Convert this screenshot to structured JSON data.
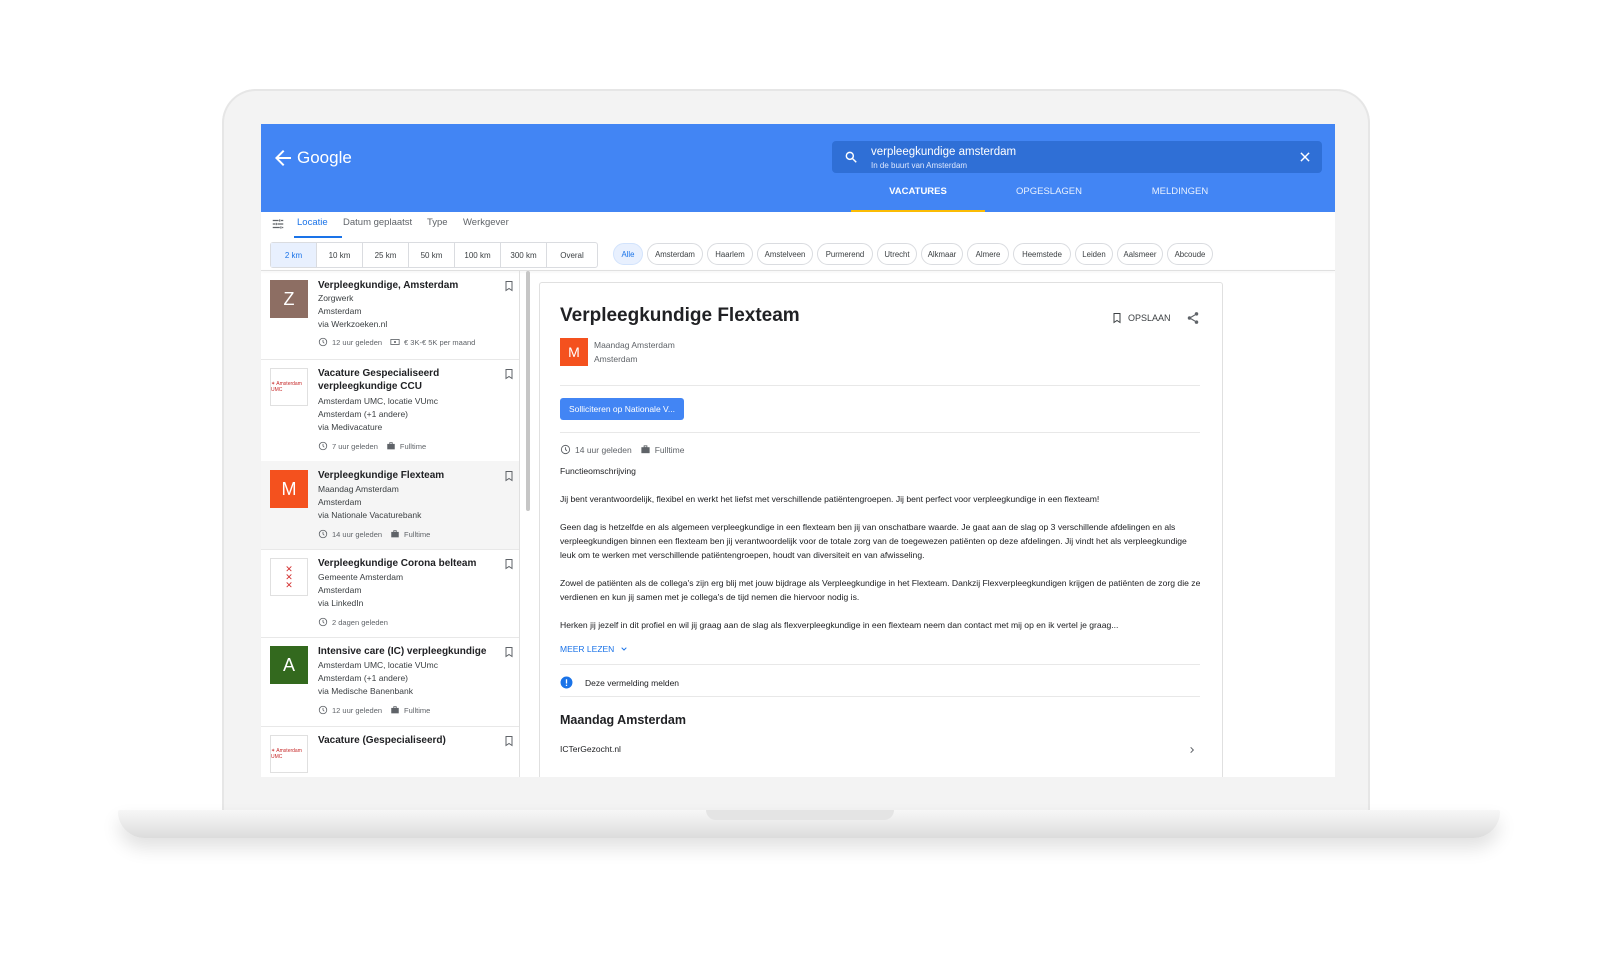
{
  "header": {
    "brand": "Google",
    "search_query": "verpleegkundige amsterdam",
    "search_subtitle": "In de buurt van Amsterdam",
    "tabs": [
      "VACATURES",
      "OPGESLAGEN",
      "MELDINGEN"
    ]
  },
  "filters": {
    "tabs": [
      "Locatie",
      "Datum geplaatst",
      "Type",
      "Werkgever"
    ],
    "distances": [
      "2 km",
      "10 km",
      "25 km",
      "50 km",
      "100 km",
      "300 km",
      "Overal"
    ],
    "chips": [
      "Alle",
      "Amsterdam",
      "Haarlem",
      "Amstelveen",
      "Purmerend",
      "Utrecht",
      "Alkmaar",
      "Almere",
      "Heemstede",
      "Leiden",
      "Aalsmeer",
      "Abcoude"
    ]
  },
  "jobs": [
    {
      "title": "Verpleegkundige, Amsterdam",
      "company": "Zorgwerk",
      "location": "Amsterdam",
      "via": "via Werkzoeken.nl",
      "age": "12 uur geleden",
      "extra": "€ 3K-€ 5K per maand",
      "logo_letter": "Z",
      "logo_color": "#8d6e63"
    },
    {
      "title": "Vacature Gespecialiseerd verpleegkundige CCU",
      "company": "Amsterdam UMC, locatie VUmc",
      "location": "Amsterdam (+1 andere)",
      "via": "via Medivacature",
      "age": "7 uur geleden",
      "extra": "Fulltime"
    },
    {
      "title": "Verpleegkundige Flexteam",
      "company": "Maandag Amsterdam",
      "location": "Amsterdam",
      "via": "via Nationale Vacaturebank",
      "age": "14 uur geleden",
      "extra": "Fulltime",
      "logo_letter": "M",
      "logo_color": "#f4511e"
    },
    {
      "title": "Verpleegkundige Corona belteam",
      "company": "Gemeente Amsterdam",
      "location": "Amsterdam",
      "via": "via LinkedIn",
      "age": "2 dagen geleden"
    },
    {
      "title": "Intensive care (IC) verpleegkundige",
      "company": "Amsterdam UMC, locatie VUmc",
      "location": "Amsterdam (+1 andere)",
      "via": "via Medische Banenbank",
      "age": "12 uur geleden",
      "extra": "Fulltime",
      "logo_letter": "A",
      "logo_color": "#33691e"
    },
    {
      "title": "Vacature (Gespecialiseerd)"
    }
  ],
  "detail": {
    "title": "Verpleegkundige Flexteam",
    "save_label": "OPSLAAN",
    "logo_letter": "M",
    "company": "Maandag Amsterdam",
    "location": "Amsterdam",
    "apply_label": "Solliciteren op Nationale V...",
    "age": "14 uur geleden",
    "type": "Fulltime",
    "section_label": "Functieomschrijving",
    "paragraphs": [
      "Jij bent verantwoordelijk, flexibel en werkt het liefst met verschillende patiëntengroepen. Jij bent perfect voor verpleegkundige in een flexteam!",
      "Geen dag is hetzelfde en als algemeen verpleegkundige in een flexteam ben jij van onschatbare waarde. Je gaat aan de slag op 3 verschillende afdelingen en als verpleegkundigen binnen een flexteam ben jij verantwoordelijk voor de totale zorg van de toegewezen patiënten op deze afdelingen. Jij vindt het als verpleegkundige leuk om te werken met verschillende patiëntengroepen, houdt van diversiteit en van afwisseling.",
      "Zowel de patiënten als de collega's zijn erg blij met jouw bijdrage als Verpleegkundige in het Flexteam. Dankzij Flexverpleegkundigen krijgen de patiënten de zorg die ze verdienen en kun jij samen met je collega's de tijd nemen die hiervoor nodig is.",
      "Herken jij jezelf in dit profiel en wil jij graag aan de slag als flexverpleegkundige in een flexteam neem dan contact met mij op en ik vertel je graag..."
    ],
    "more_label": "MEER LEZEN",
    "report_label": "Deze vermelding melden",
    "employer_heading": "Maandag Amsterdam",
    "site": "ICTerGezocht.nl"
  },
  "colors": {
    "brand_blue": "#4285f4",
    "accent_yellow": "#fbbc04",
    "link_blue": "#1a73e8"
  }
}
